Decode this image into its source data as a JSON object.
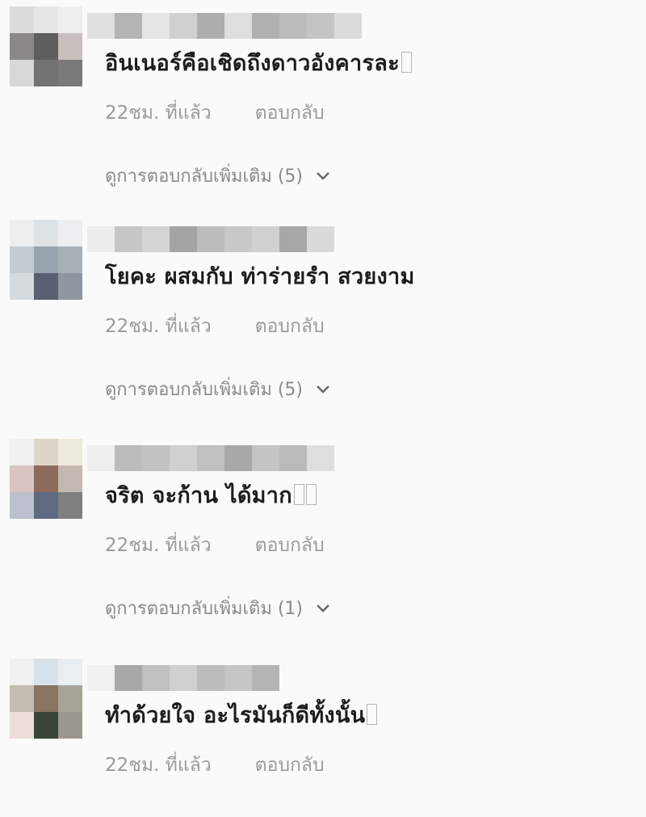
{
  "comments": [
    {
      "text": "อินเนอร์คือเชิดถึงดาวอังคารละ",
      "boxes": 1,
      "time": "22ชม. ที่แล้ว",
      "reply_label": "ตอบกลับ",
      "more_replies": "ดูการตอบกลับเพิ่มเติม (5)",
      "avatar_colors": [
        "#dcdcdc",
        "#e6e6e6",
        "#efefef",
        "#8a8888",
        "#5f5e5e",
        "#c9bfbe",
        "#d8d8d8",
        "#737272",
        "#7b7a7a"
      ],
      "name_colors": [
        "#e0e0e0",
        "#b4b4b4",
        "#e4e4e4",
        "#d0d0d0",
        "#adadad",
        "#dedede",
        "#b0b0b0",
        "#bcbcbc",
        "#c4c4c4",
        "#dcdcdc"
      ]
    },
    {
      "text": "โยคะ ผสมกับ ท่าร่ายรำ สวยงาม",
      "boxes": 0,
      "time": "22ชม. ที่แล้ว",
      "reply_label": "ตอบกลับ",
      "more_replies": "ดูการตอบกลับเพิ่มเติม (5)",
      "avatar_colors": [
        "#eeeeee",
        "#dde2e6",
        "#eceef0",
        "#c2cbd0",
        "#9aa4ae",
        "#a8b0b7",
        "#d4dadd",
        "#5a6072",
        "#8e97a0"
      ],
      "name_colors": [
        "#ececec",
        "#c6c6c6",
        "#d4d4d4",
        "#a4a4a4",
        "#bcbcbc",
        "#c8c8c8",
        "#d0d0d0",
        "#a8a8a8",
        "#dadada"
      ]
    },
    {
      "text": "จริต จะก้าน ได้มาก",
      "boxes": 2,
      "time": "22ชม. ที่แล้ว",
      "reply_label": "ตอบกลับ",
      "more_replies": "ดูการตอบกลับเพิ่มเติม (1)",
      "avatar_colors": [
        "#f1f1f1",
        "#ddd6c8",
        "#efeade",
        "#d8c4c0",
        "#8c6a5c",
        "#c4b8b2",
        "#bcc0cc",
        "#5f6a80",
        "#7f7f7f"
      ],
      "name_colors": [
        "#eeeeee",
        "#bcbcbc",
        "#c2c2c2",
        "#d0d0d0",
        "#c0c0c0",
        "#a8a8a8",
        "#c4c4c4",
        "#bababa",
        "#dedede"
      ]
    },
    {
      "text": "ทำด้วยใจ อะไรมันก็ดีทั้งนั้น",
      "boxes": 1,
      "time": "22ชม. ที่แล้ว",
      "reply_label": "ตอบกลับ",
      "more_replies": "",
      "avatar_colors": [
        "#f0f0f0",
        "#d8e2ea",
        "#e8eef2",
        "#c4bcb2",
        "#8a7462",
        "#a8a498",
        "#eedcd8",
        "#3a4438",
        "#9c9890"
      ],
      "name_colors": [
        "#f0f0f0",
        "#a8a8a8",
        "#c0c0c0",
        "#d0d0d0",
        "#bcbcbc",
        "#c6c6c6",
        "#b4b4b4"
      ]
    }
  ]
}
